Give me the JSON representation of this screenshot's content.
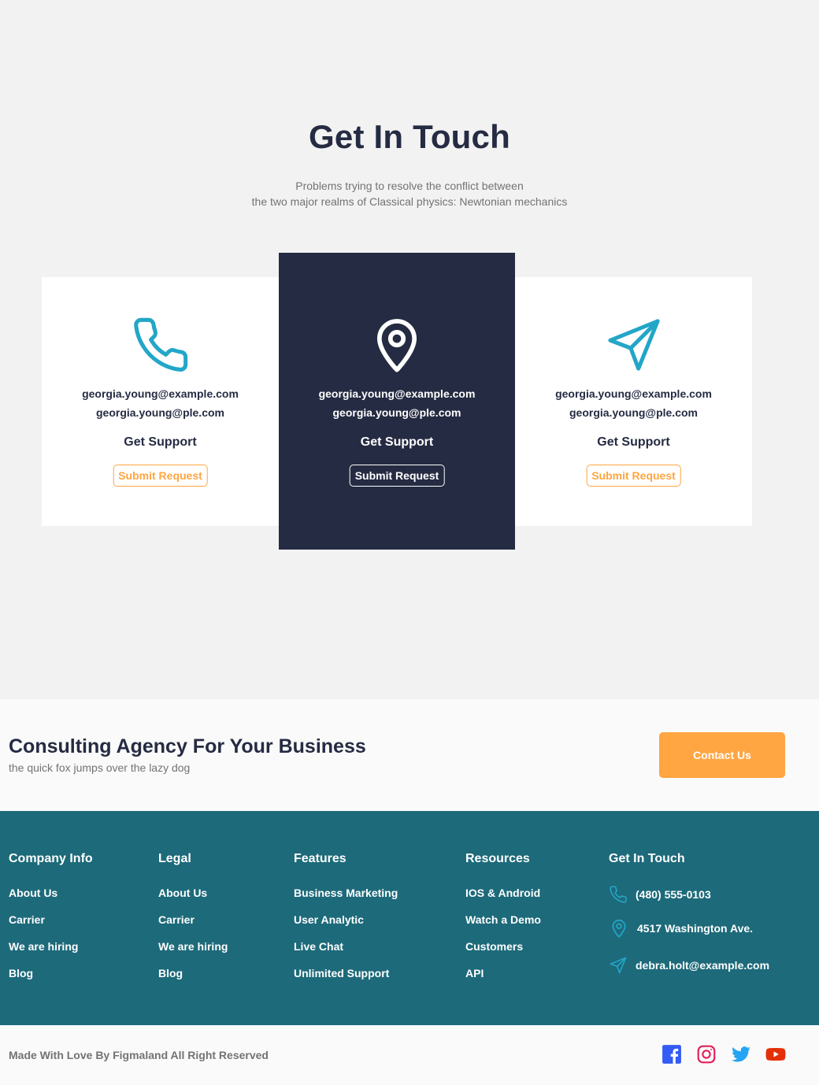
{
  "hero": {
    "title": "Get In Touch",
    "subtitle_line1": "Problems trying to resolve the conflict between",
    "subtitle_line2": "the two major realms of Classical physics: Newtonian mechanics"
  },
  "cards": [
    {
      "icon": "phone-icon",
      "email1": "georgia.young@example.com",
      "email2": "georgia.young@ple.com",
      "title": "Get Support",
      "button": "Submit Request"
    },
    {
      "icon": "location-pin-icon",
      "email1": "georgia.young@example.com",
      "email2": "georgia.young@ple.com",
      "title": "Get Support",
      "button": "Submit Request"
    },
    {
      "icon": "paper-plane-icon",
      "email1": "georgia.young@example.com",
      "email2": "georgia.young@ple.com",
      "title": "Get Support",
      "button": "Submit Request"
    }
  ],
  "cta": {
    "title": "Consulting Agency For Your Business",
    "subtitle": "the quick fox jumps over the lazy dog",
    "button": "Contact Us"
  },
  "footer": {
    "columns": [
      {
        "title": "Company Info",
        "links": [
          "About Us",
          "Carrier",
          "We are hiring",
          "Blog"
        ]
      },
      {
        "title": "Legal",
        "links": [
          "About Us",
          "Carrier",
          "We are hiring",
          "Blog"
        ]
      },
      {
        "title": "Features",
        "links": [
          "Business Marketing",
          "User Analytic",
          "Live Chat",
          "Unlimited Support"
        ]
      },
      {
        "title": "Resources",
        "links": [
          "IOS & Android",
          "Watch a Demo",
          "Customers",
          "API"
        ]
      }
    ],
    "contact": {
      "title": "Get In Touch",
      "phone": "(480) 555-0103",
      "address": "4517 Washington Ave.",
      "email": "debra.holt@example.com"
    }
  },
  "bottom": {
    "copyright": "Made With Love By Figmaland All Right Reserved",
    "social": [
      "facebook-icon",
      "instagram-icon",
      "twitter-icon",
      "youtube-icon"
    ]
  },
  "colors": {
    "primary_dark": "#252b42",
    "accent_orange": "#ffa541",
    "icon_teal": "#23a6c8",
    "footer_teal": "#1d6a7a",
    "muted_text": "#737373"
  }
}
